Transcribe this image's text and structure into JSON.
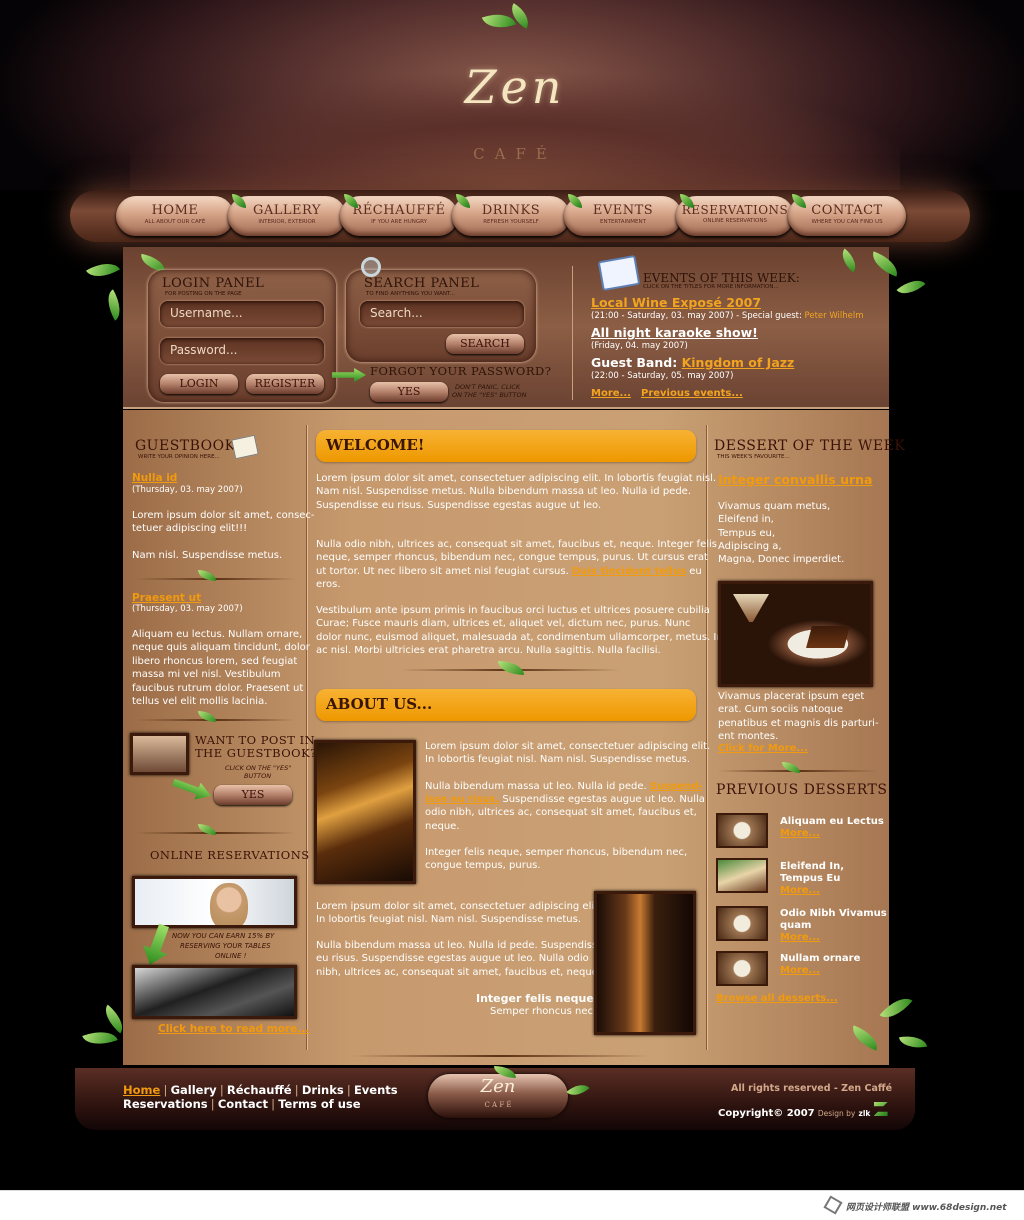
{
  "header": {
    "logo_script": "Zen",
    "logo_sub": "CAFÉ"
  },
  "nav": {
    "items": [
      {
        "label": "HOME",
        "sub": "All about our Café"
      },
      {
        "label": "GALLERY",
        "sub": "Interior, Exterior"
      },
      {
        "label": "RÉCHAUFFÉ",
        "sub": "If you are hungry"
      },
      {
        "label": "DRINKS",
        "sub": "Refresh yourself"
      },
      {
        "label": "EVENTS",
        "sub": "Entertainment"
      },
      {
        "label": "RESERVATIONS",
        "sub": "Online reservations"
      },
      {
        "label": "CONTACT",
        "sub": "Where you can find us"
      }
    ]
  },
  "login": {
    "title": "LOGIN PANEL",
    "sub": "For posting on the page",
    "username_placeholder": "Username...",
    "password_placeholder": "Password...",
    "login": "LOGIN",
    "register": "REGISTER"
  },
  "search": {
    "title": "SEARCH PANEL",
    "sub": "To find anything you want...",
    "placeholder": "Search...",
    "button": "SEARCH",
    "forgot": "FORGOT YOUR PASSWORD?",
    "yes": "YES",
    "note1": "Don't panic, click",
    "note2": "on the \"yes\" button"
  },
  "events": {
    "title": "EVENTS OF THIS WEEK:",
    "sub": "Click on the titles for more information...",
    "items": [
      {
        "title": "Local Wine Exposé 2007",
        "date": "(21:00 - Saturday, 03. may 2007) - Special guest: ",
        "guest": "Peter Wilhelm"
      },
      {
        "title": "All night karaoke show!",
        "date": "(Friday, 04. may 2007)"
      },
      {
        "title_prefix": "Guest Band: ",
        "title": "Kingdom of Jazz",
        "date": "(22:00 - Saturday, 05. may 2007)"
      }
    ],
    "more": "More...",
    "previous": "Previous events..."
  },
  "guestbook": {
    "title": "GUESTBOOK",
    "sub": "Write your opinion here...",
    "entries": [
      {
        "name": "Nulla id",
        "date": "(Thursday, 03. may 2007)",
        "text1": "Lorem ipsum dolor sit amet, consec-",
        "text2": "tetuer adipiscing elit!!!",
        "text3": "Nam nisl. Suspendisse metus."
      },
      {
        "name": "Praesent ut",
        "date": "(Thursday, 03. may 2007)",
        "lines": [
          "Aliquam eu lectus. Nullam ornare,",
          "neque quis aliquam tincidunt, dolor",
          "libero rhoncus lorem, sed feugiat",
          "massa mi vel nisl. Vestibulum",
          "faucibus rutrum dolor. Praesent ut",
          "tellus vel elit mollis lacinia."
        ]
      }
    ],
    "want1": "WANT TO POST IN",
    "want2": "THE GUESTBOOK?",
    "click1": "Click on the \"yes\"",
    "click2": "button",
    "yes": "YES"
  },
  "reservations": {
    "title": "ONLINE RESERVATIONS",
    "note1": "Now you can earn 15% by",
    "note2": "reserving your tables",
    "note3": "online !",
    "link": "Click here to read more..."
  },
  "welcome": {
    "title": "WELCOME!",
    "p1": [
      "Lorem ipsum dolor sit amet, consectetuer adipiscing elit. In lobortis feugiat nisl.",
      "Nam nisl. Suspendisse metus. Nulla bibendum massa ut leo. Nulla id pede.",
      "Suspendisse eu risus. Suspendisse egestas augue ut leo."
    ],
    "p2": [
      "Nulla odio nibh, ultrices ac, consequat sit amet, faucibus et, neque. Integer felis",
      "neque, semper rhoncus, bibendum nec, congue tempus, purus. Ut cursus erat"
    ],
    "p2c": "ut tortor. Ut nec libero sit amet nisl feugiat cursus. ",
    "p2link": "Duis tincidunt tellus",
    "p2end": " eu",
    "p2last": "eros.",
    "p3": [
      "Vestibulum ante ipsum primis in faucibus orci luctus et ultrices posuere cubilia",
      "Curae; Fusce mauris diam, ultrices et, aliquet vel, dictum nec, purus. Nunc",
      "dolor nunc, euismod aliquet, malesuada at, condimentum ullamcorper, metus. In",
      "ac nisl. Morbi ultricies erat pharetra arcu. Nulla sagittis. Nulla facilisi."
    ]
  },
  "about": {
    "title": "ABOUT US...",
    "a1": [
      "Lorem ipsum dolor sit amet, consectetuer adipiscing elit.",
      "In lobortis feugiat nisl. Nam nisl. Suspendisse metus."
    ],
    "a2a": "Nulla bibendum massa ut leo. Nulla id pede. ",
    "a2link1": "Suspend-",
    "a2link2": "isse eu risus.",
    "a2b": " Suspendisse egestas augue ut leo. Nulla",
    "a2c": "odio nibh, ultrices ac, consequat sit amet, faucibus et,",
    "a2d": "neque.",
    "a3": [
      "Integer felis neque, semper rhoncus, bibendum nec,",
      "congue tempus, purus."
    ],
    "b1": [
      "Lorem ipsum dolor sit amet, consectetuer adipiscing elit.",
      "In lobortis feugiat nisl. Nam nisl. Suspendisse metus."
    ],
    "b2": [
      "Nulla bibendum massa ut leo. Nulla id pede. Suspendisse",
      "eu risus. Suspendisse egestas augue ut leo. Nulla odio",
      "nibh, ultrices ac, consequat sit amet, faucibus et, neque."
    ],
    "quote": "Integer felis neque,",
    "quote2": "Semper rhoncus nec."
  },
  "dessert": {
    "title": "DESSERT OF THE WEEK",
    "sub": "This week's favourite...",
    "name": "Integer convallis urna",
    "lines": [
      "Vivamus quam metus,",
      "Eleifend in,",
      "Tempus eu,",
      "Adipiscing a,",
      "Magna, Donec imperdiet."
    ],
    "desc": [
      "Vivamus placerat ipsum eget",
      "erat. Cum sociis natoque",
      "penatibus et magnis dis parturi-",
      "ent montes."
    ],
    "more": "Click for More..."
  },
  "previous": {
    "title": "PREVIOUS DESSERTS",
    "items": [
      {
        "l1": "Aliquam eu Lectus",
        "l2": "",
        "more": "More..."
      },
      {
        "l1": "Eleifend In,",
        "l2": "Tempus Eu",
        "more": "More..."
      },
      {
        "l1": "Odio Nibh Vivamus",
        "l2": "quam",
        "more": "More..."
      },
      {
        "l1": "Nullam ornare",
        "l2": "",
        "more": "More..."
      }
    ],
    "browse": "Browse all desserts..."
  },
  "footer": {
    "links1": [
      "Home",
      "Gallery",
      "Réchauffé",
      "Drinks",
      "Events"
    ],
    "links2": [
      "Reservations",
      "Contact",
      "Terms of use"
    ],
    "rights": "All rights reserved - Zen Caffé",
    "copyright": "Copyright© 2007",
    "design": "Design by",
    "designer": "zlk",
    "logo": "Zen",
    "logo_sub": "C A F É"
  },
  "watermark": {
    "text": "网页设计师联盟 www.68design.net"
  },
  "colors": {
    "accent": "#f29a0d",
    "link_orange": "#f2a421"
  }
}
